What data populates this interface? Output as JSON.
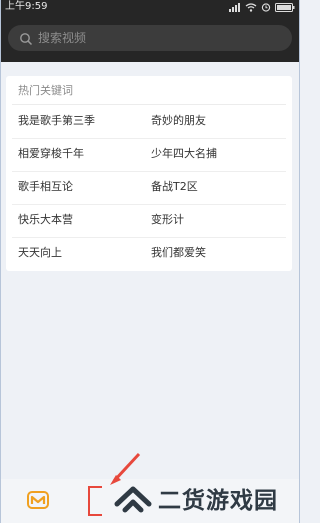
{
  "status_bar": {
    "time": "上午9:59"
  },
  "search": {
    "placeholder": "搜索视频"
  },
  "hot_keywords": {
    "title": "热门关键词",
    "rows": [
      [
        "我是歌手第三季",
        "奇妙的朋友"
      ],
      [
        "相爱穿梭千年",
        "少年四大名捕"
      ],
      [
        "歌手相互论",
        "备战T2区"
      ],
      [
        "快乐大本营",
        "变形计"
      ],
      [
        "天天向上",
        "我们都爱笑"
      ]
    ]
  },
  "watermark": {
    "text": "二货游戏园"
  },
  "colors": {
    "header_bg": "#262626",
    "page_bg": "#eef1f6",
    "brand_orange": "#f0a020",
    "annotation_red": "#e7483c"
  }
}
